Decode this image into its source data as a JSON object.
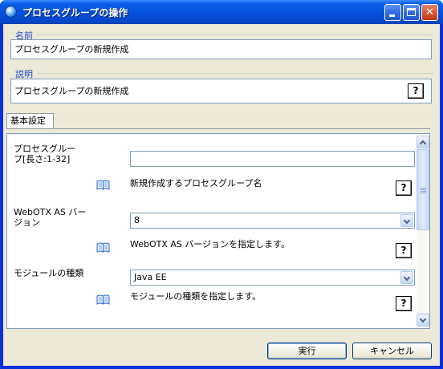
{
  "window": {
    "title": "プロセスグループの操作",
    "minimize_glyph": "",
    "close_glyph": "✕"
  },
  "name_group": {
    "label": "名前",
    "value": "プロセスグループの新規作成"
  },
  "desc_group": {
    "label": "説明",
    "value": "プロセスグループの新規作成",
    "help": "?"
  },
  "tab": {
    "label": "基本設定"
  },
  "fields": [
    {
      "label_line1": "プロセスグルー",
      "label_line2": "プ[長さ:1-32]",
      "value": "",
      "description": "新規作成するプロセスグループ名",
      "help": "?"
    },
    {
      "label_line1": "WebOTX AS バー",
      "label_line2": "ジョン",
      "value": "8",
      "description": "WebOTX AS バージョンを指定します。",
      "help": "?"
    },
    {
      "label_line1": "モジュールの種類",
      "label_line2": "",
      "value": "Java EE",
      "description": "モジュールの種類を指定します。",
      "help": "?"
    }
  ],
  "buttons": {
    "run": "実行",
    "cancel": "キャンセル"
  },
  "colors": {
    "titlebar": "#0550dd",
    "group_label": "#1c46c8",
    "dialog_bg": "#ece9d8",
    "field_border": "#7f9db9"
  },
  "icons": {
    "app": "app-globe-icon",
    "help": "help-question-icon",
    "info": "open-book-icon"
  }
}
